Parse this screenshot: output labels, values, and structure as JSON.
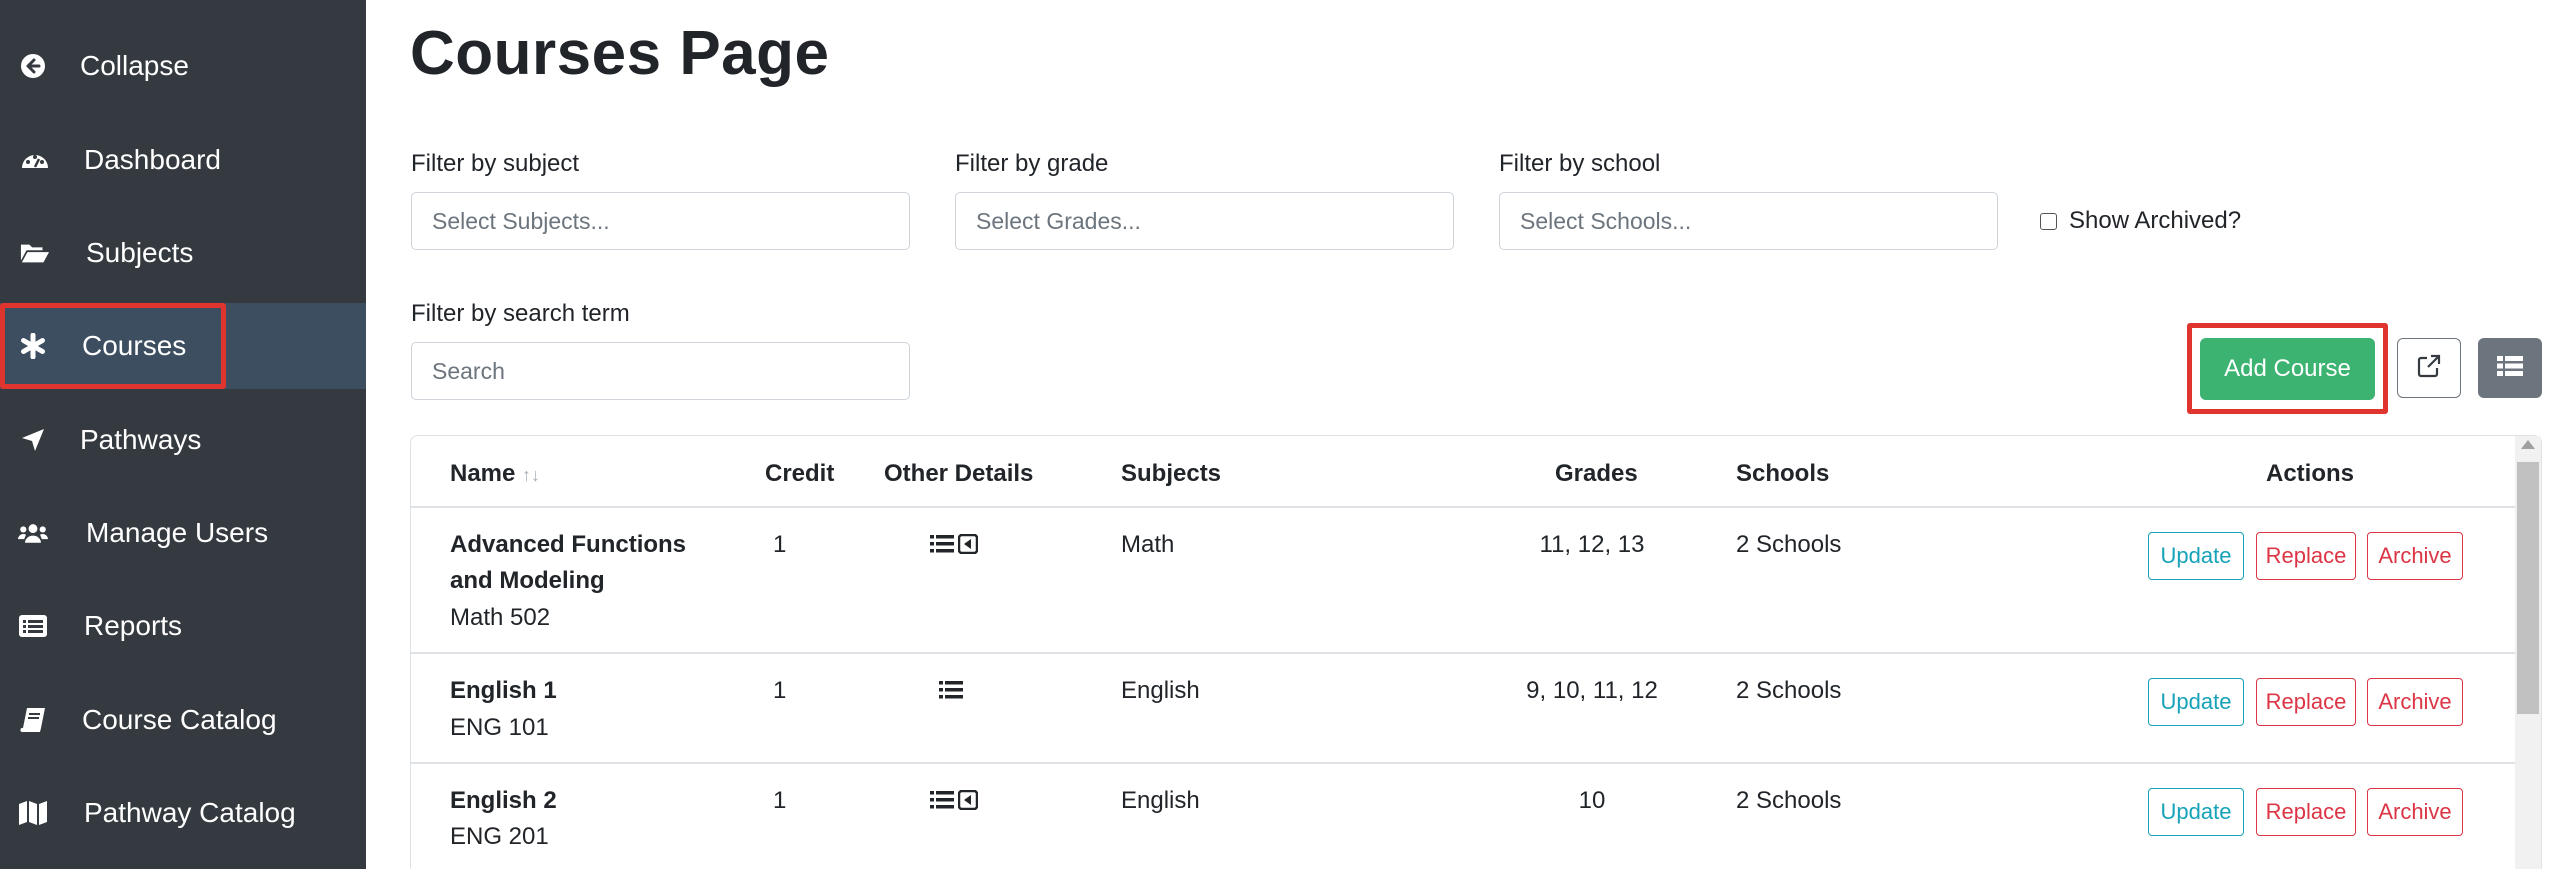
{
  "sidebar": {
    "items": [
      {
        "label": "Collapse",
        "icon": "arrow-circle-left-icon"
      },
      {
        "label": "Dashboard",
        "icon": "tachometer-icon"
      },
      {
        "label": "Subjects",
        "icon": "folder-open-icon"
      },
      {
        "label": "Courses",
        "icon": "asterisk-icon",
        "active": true
      },
      {
        "label": "Pathways",
        "icon": "location-arrow-icon"
      },
      {
        "label": "Manage Users",
        "icon": "users-icon"
      },
      {
        "label": "Reports",
        "icon": "list-alt-icon"
      },
      {
        "label": "Course Catalog",
        "icon": "book-icon"
      },
      {
        "label": "Pathway Catalog",
        "icon": "map-icon"
      }
    ]
  },
  "main": {
    "title": "Courses Page",
    "filters": {
      "subject": {
        "label": "Filter by subject",
        "placeholder": "Select Subjects..."
      },
      "grade": {
        "label": "Filter by grade",
        "placeholder": "Select Grades..."
      },
      "school": {
        "label": "Filter by school",
        "placeholder": "Select Schools..."
      },
      "search": {
        "label": "Filter by search term",
        "placeholder": "Search"
      },
      "show_archived": "Show Archived?"
    },
    "toolbar": {
      "add_course": "Add Course",
      "export_icon": "external-link-icon",
      "list_icon": "list-view-icon"
    },
    "table": {
      "headers": {
        "name": "Name",
        "sort_icon": "↑↓",
        "credit": "Credit",
        "other_details": "Other Details",
        "subjects": "Subjects",
        "grades": "Grades",
        "schools": "Schools",
        "actions": "Actions"
      },
      "action_labels": {
        "update": "Update",
        "replace": "Replace",
        "archive": "Archive"
      },
      "rows": [
        {
          "name_line1": "Advanced Functions",
          "name_line2": "and Modeling",
          "code": "Math 502",
          "credit": "1",
          "details": [
            "list-icon",
            "caret-square-left-icon"
          ],
          "subjects": "Math",
          "grades": "11, 12, 13",
          "schools": "2 Schools"
        },
        {
          "name_line1": "English 1",
          "name_line2": "",
          "code": "ENG 101",
          "credit": "1",
          "details": [
            "list-icon"
          ],
          "subjects": "English",
          "grades": "9, 10, 11, 12",
          "schools": "2 Schools"
        },
        {
          "name_line1": "English 2",
          "name_line2": "",
          "code": "ENG 201",
          "credit": "1",
          "details": [
            "list-icon",
            "caret-square-left-icon"
          ],
          "subjects": "English",
          "grades": "10",
          "schools": "2 Schools"
        }
      ]
    }
  },
  "colors": {
    "sidebar_bg": "#343a40",
    "sidebar_active": "#3c4e60",
    "highlight": "#e0342e",
    "add_button": "#3cb371",
    "update": "#17a2b8",
    "danger": "#dc3545"
  }
}
